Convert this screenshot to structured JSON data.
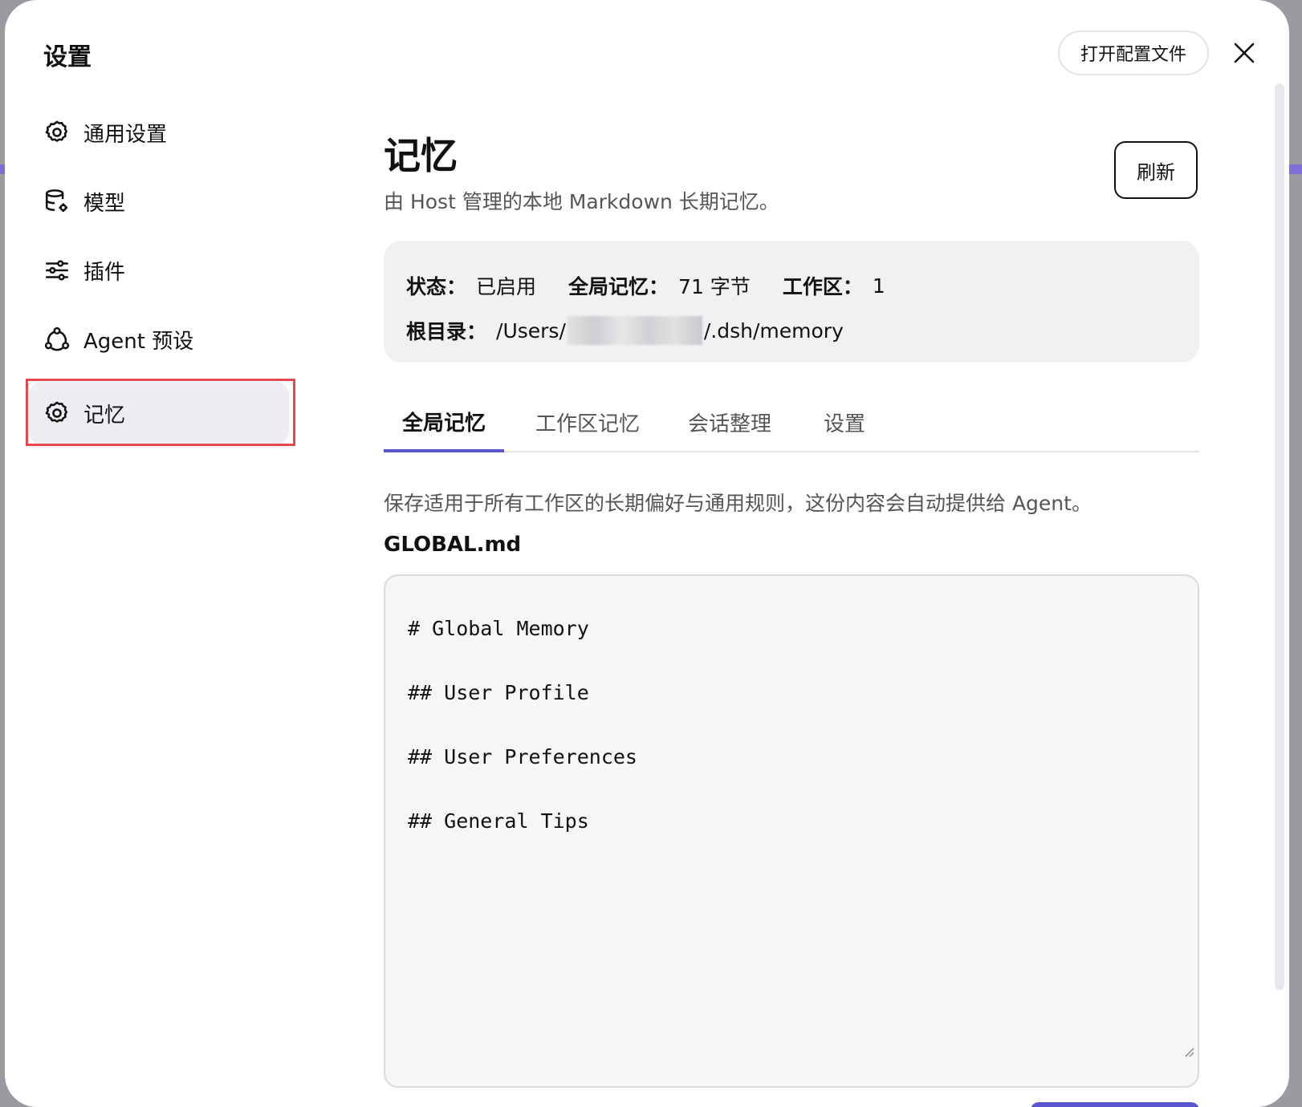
{
  "window": {
    "title": "设置",
    "open_config_label": "打开配置文件"
  },
  "sidebar": {
    "items": [
      {
        "label": "通用设置",
        "icon": "gear-icon"
      },
      {
        "label": "模型",
        "icon": "database-gear-icon"
      },
      {
        "label": "插件",
        "icon": "sliders-icon"
      },
      {
        "label": "Agent 预设",
        "icon": "agent-network-icon"
      },
      {
        "label": "记忆",
        "icon": "gear-icon",
        "active": true
      }
    ]
  },
  "main": {
    "title": "记忆",
    "subtitle": "由 Host 管理的本地 Markdown 长期记忆。",
    "refresh_label": "刷新",
    "status": {
      "status_key": "状态：",
      "status_value": "已启用",
      "global_key": "全局记忆：",
      "global_value": "71 字节",
      "workspace_key": "工作区：",
      "workspace_value": "1",
      "root_key": "根目录：",
      "root_prefix": "/Users/",
      "root_suffix": "/.dsh/memory"
    },
    "tabs": [
      {
        "label": "全局记忆",
        "active": true
      },
      {
        "label": "工作区记忆"
      },
      {
        "label": "会话整理"
      },
      {
        "label": "设置"
      }
    ],
    "description": "保存适用于所有工作区的长期偏好与通用规则，这份内容会自动提供给 Agent。",
    "file_name": "GLOBAL.md",
    "editor_lines": [
      "# Global Memory",
      "## User Profile",
      "## User Preferences",
      "## General Tips"
    ]
  },
  "colors": {
    "accent": "#5b57d1",
    "highlight_outline": "#e5484d"
  }
}
